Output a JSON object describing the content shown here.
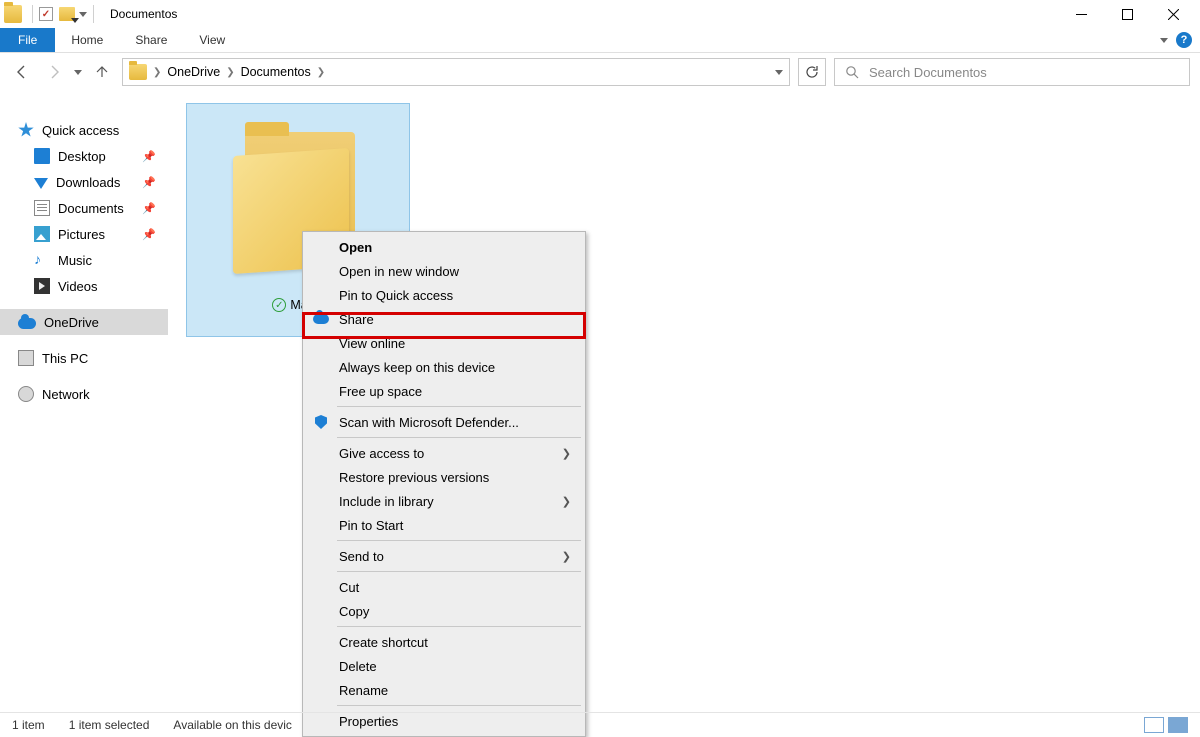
{
  "window": {
    "title": "Documentos"
  },
  "ribbon": {
    "file": "File",
    "home": "Home",
    "share": "Share",
    "view": "View"
  },
  "breadcrumb": {
    "root": "OneDrive",
    "current": "Documentos"
  },
  "search": {
    "placeholder": "Search Documentos"
  },
  "nav": {
    "quick": "Quick access",
    "desktop": "Desktop",
    "downloads": "Downloads",
    "documents": "Documents",
    "pictures": "Pictures",
    "music": "Music",
    "videos": "Videos",
    "onedrive": "OneDrive",
    "thispc": "This PC",
    "network": "Network"
  },
  "item": {
    "name": "Malav"
  },
  "ctx": {
    "open": "Open",
    "open_new": "Open in new window",
    "pin_qa": "Pin to Quick access",
    "share": "Share",
    "view_online": "View online",
    "always_keep": "Always keep on this device",
    "free_up": "Free up space",
    "defender": "Scan with Microsoft Defender...",
    "give_access": "Give access to",
    "restore_prev": "Restore previous versions",
    "include_lib": "Include in library",
    "pin_start": "Pin to Start",
    "send_to": "Send to",
    "cut": "Cut",
    "copy": "Copy",
    "create_sc": "Create shortcut",
    "delete": "Delete",
    "rename": "Rename",
    "properties": "Properties"
  },
  "status": {
    "count": "1 item",
    "selected": "1 item selected",
    "avail": "Available on this devic"
  }
}
